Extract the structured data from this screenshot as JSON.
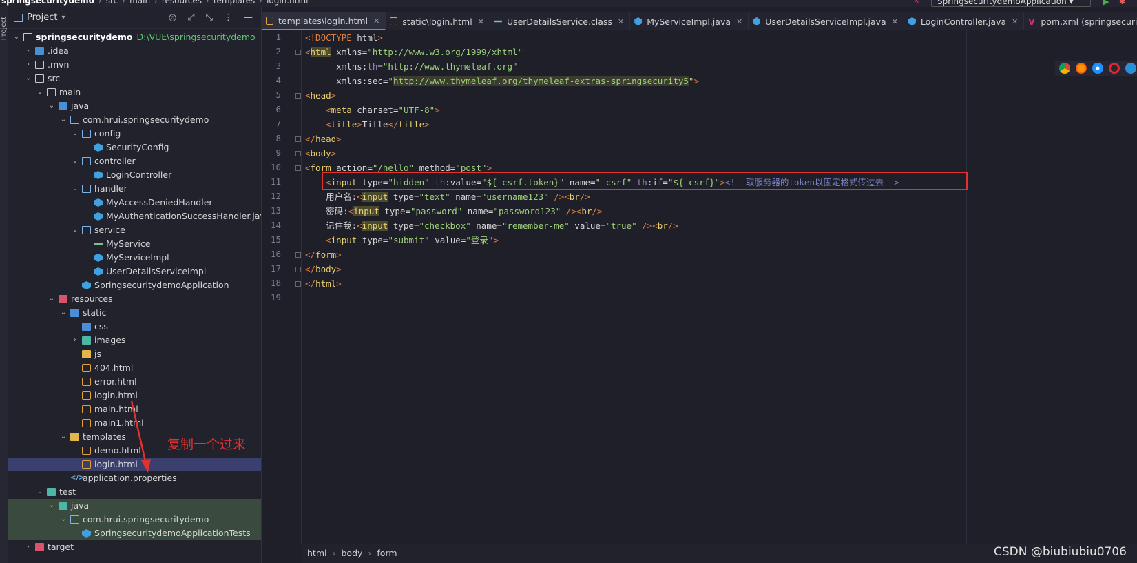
{
  "topbar": {
    "crumbs": [
      "springsecuritydemo",
      "src",
      "main",
      "resources",
      "templates",
      "login.html"
    ],
    "run_config": "SpringsecuritydemoApplication"
  },
  "toolstrip": {
    "label": "Project"
  },
  "project": {
    "title": "Project",
    "tree": [
      {
        "depth": 0,
        "arrow": "v",
        "icon": "folder",
        "name": "springsecuritydemo",
        "bold": true,
        "path": "D:\\VUE\\springsecuritydemo"
      },
      {
        "depth": 1,
        "arrow": ">",
        "icon": "folder-blue",
        "name": ".idea"
      },
      {
        "depth": 1,
        "arrow": ">",
        "icon": "folder",
        "name": ".mvn"
      },
      {
        "depth": 1,
        "arrow": "v",
        "icon": "folder",
        "name": "src"
      },
      {
        "depth": 2,
        "arrow": "v",
        "icon": "folder",
        "name": "main"
      },
      {
        "depth": 3,
        "arrow": "v",
        "icon": "folder-blue",
        "name": "java"
      },
      {
        "depth": 4,
        "arrow": "v",
        "icon": "pkg",
        "name": "com.hrui.springsecuritydemo"
      },
      {
        "depth": 5,
        "arrow": "v",
        "icon": "pkg",
        "name": "config"
      },
      {
        "depth": 6,
        "arrow": "",
        "icon": "class",
        "name": "SecurityConfig"
      },
      {
        "depth": 5,
        "arrow": "v",
        "icon": "pkg",
        "name": "controller"
      },
      {
        "depth": 6,
        "arrow": "",
        "icon": "class",
        "name": "LoginController"
      },
      {
        "depth": 5,
        "arrow": "v",
        "icon": "pkg",
        "name": "handler"
      },
      {
        "depth": 6,
        "arrow": "",
        "icon": "class",
        "name": "MyAccessDeniedHandler"
      },
      {
        "depth": 6,
        "arrow": "",
        "icon": "class",
        "name": "MyAuthenticationSuccessHandler.jav"
      },
      {
        "depth": 5,
        "arrow": "v",
        "icon": "pkg",
        "name": "service"
      },
      {
        "depth": 6,
        "arrow": "",
        "icon": "iface",
        "name": "MyService"
      },
      {
        "depth": 6,
        "arrow": "",
        "icon": "class",
        "name": "MyServiceImpl"
      },
      {
        "depth": 6,
        "arrow": "",
        "icon": "class",
        "name": "UserDetailsServiceImpl"
      },
      {
        "depth": 5,
        "arrow": "",
        "icon": "class",
        "name": "SpringsecuritydemoApplication"
      },
      {
        "depth": 3,
        "arrow": "v",
        "icon": "folder-red",
        "name": "resources"
      },
      {
        "depth": 4,
        "arrow": "v",
        "icon": "folder-blue",
        "name": "static"
      },
      {
        "depth": 5,
        "arrow": "",
        "icon": "folder-blue",
        "name": "css"
      },
      {
        "depth": 5,
        "arrow": ">",
        "icon": "folder-teal",
        "name": "images"
      },
      {
        "depth": 5,
        "arrow": "",
        "icon": "folder-yellow",
        "name": "js"
      },
      {
        "depth": 5,
        "arrow": "",
        "icon": "html",
        "name": "404.html"
      },
      {
        "depth": 5,
        "arrow": "",
        "icon": "html",
        "name": "error.html"
      },
      {
        "depth": 5,
        "arrow": "",
        "icon": "html",
        "name": "login.html"
      },
      {
        "depth": 5,
        "arrow": "",
        "icon": "html",
        "name": "main.html"
      },
      {
        "depth": 5,
        "arrow": "",
        "icon": "html",
        "name": "main1.html"
      },
      {
        "depth": 4,
        "arrow": "v",
        "icon": "folder-yellow",
        "name": "templates"
      },
      {
        "depth": 5,
        "arrow": "",
        "icon": "html",
        "name": "demo.html"
      },
      {
        "depth": 5,
        "arrow": "",
        "icon": "html",
        "name": "login.html",
        "selected": true
      },
      {
        "depth": 4,
        "arrow": "",
        "icon": "props",
        "name": "application.properties"
      },
      {
        "depth": 2,
        "arrow": "v",
        "icon": "folder-teal",
        "name": "test"
      },
      {
        "depth": 3,
        "arrow": "v",
        "icon": "folder-teal",
        "name": "java",
        "testbg": true
      },
      {
        "depth": 4,
        "arrow": "v",
        "icon": "pkg",
        "name": "com.hrui.springsecuritydemo",
        "testbg": true
      },
      {
        "depth": 5,
        "arrow": "",
        "icon": "class",
        "name": "SpringsecuritydemoApplicationTests",
        "testbg": true
      },
      {
        "depth": 1,
        "arrow": ">",
        "icon": "folder-red",
        "name": "target"
      }
    ]
  },
  "tabs": [
    {
      "label": "templates\\login.html",
      "icon": "html",
      "active": true
    },
    {
      "label": "static\\login.html",
      "icon": "html"
    },
    {
      "label": "UserDetailsService.class",
      "icon": "iface"
    },
    {
      "label": "MyServiceImpl.java",
      "icon": "class"
    },
    {
      "label": "UserDetailsServiceImpl.java",
      "icon": "class"
    },
    {
      "label": "LoginController.java",
      "icon": "class"
    },
    {
      "label": "pom.xml (springsecuritydemo)",
      "icon": "maven"
    }
  ],
  "code_lines": [
    "1",
    "2",
    "3",
    "4",
    "5",
    "6",
    "7",
    "8",
    "9",
    "10",
    "11",
    "12",
    "13",
    "14",
    "15",
    "16",
    "17",
    "18",
    "19"
  ],
  "annotation": {
    "text": "复制一个过来"
  },
  "editor_crumbs": [
    "html",
    "body",
    "form"
  ],
  "watermark": "CSDN @biubiubiu0706",
  "colors": {
    "accent": "#6f8ad6",
    "highlight_box": "#e53030",
    "selected_row": "#3b3f6e"
  }
}
